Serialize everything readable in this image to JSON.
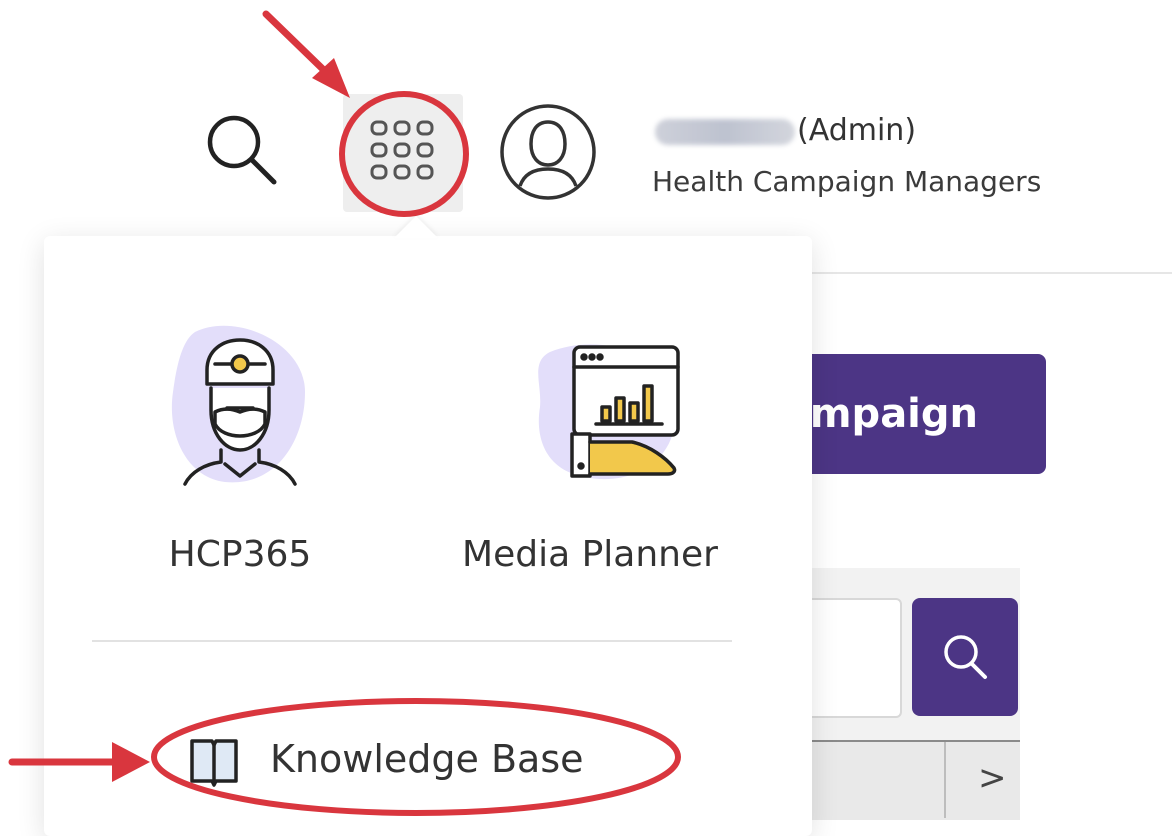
{
  "header": {
    "search_icon": "search-icon",
    "apps_icon": "grid-apps-icon",
    "avatar_icon": "user-avatar-icon",
    "user_role": "(Admin)",
    "user_org": "Health Campaign Managers"
  },
  "background_page": {
    "campaign_button_label": "mpaign",
    "search_button_icon": "search-icon",
    "pager_next_label": ">"
  },
  "app_menu": {
    "apps": [
      {
        "label": "HCP365",
        "icon": "doctor-icon"
      },
      {
        "label": "Media Planner",
        "icon": "media-planner-icon"
      }
    ],
    "links": [
      {
        "label": "Knowledge Base",
        "icon": "book-icon"
      }
    ]
  },
  "colors": {
    "brand_purple": "#4c3585",
    "annotation_red": "#d9363e",
    "icon_blob_lavender": "#e3defa",
    "gold": "#f2c84b"
  }
}
